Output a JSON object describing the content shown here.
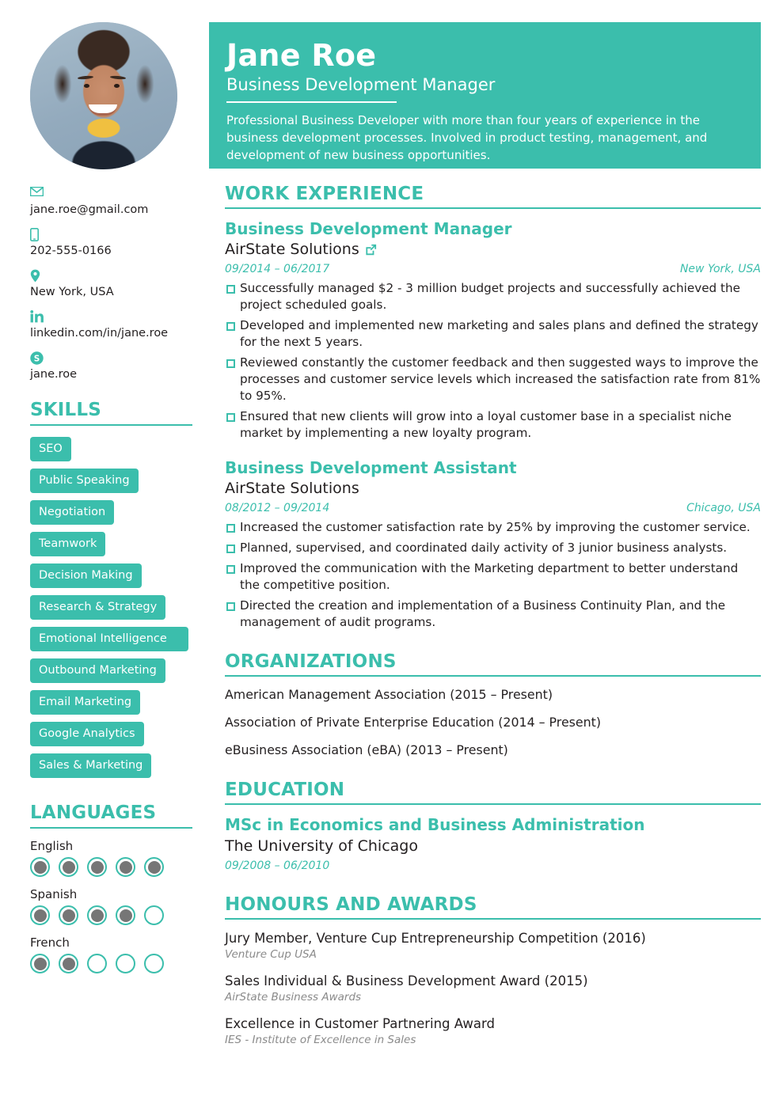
{
  "header": {
    "name": "Jane Roe",
    "role": "Business Development Manager",
    "summary": "Professional Business Developer with more than four years of experience in the business development processes. Involved in product testing, management, and development of new business opportunities.",
    "accent_color": "#3bbeac"
  },
  "contact": [
    {
      "icon": "envelope-icon",
      "text": "jane.roe@gmail.com"
    },
    {
      "icon": "phone-icon",
      "text": "202-555-0166"
    },
    {
      "icon": "location-pin-icon",
      "text": "New York, USA"
    },
    {
      "icon": "linkedin-icon",
      "text": "linkedin.com/in/jane.roe"
    },
    {
      "icon": "skype-icon",
      "text": "jane.roe"
    }
  ],
  "skills": {
    "heading": "SKILLS",
    "items": [
      "SEO",
      "Public Speaking",
      "Negotiation",
      "Teamwork",
      "Decision Making",
      "Research & Strategy",
      "Emotional Intelligence",
      "Outbound Marketing",
      "Email Marketing",
      "Google Analytics",
      "Sales & Marketing"
    ]
  },
  "languages": {
    "heading": "LANGUAGES",
    "items": [
      {
        "name": "English",
        "level": 5,
        "max": 5
      },
      {
        "name": "Spanish",
        "level": 4,
        "max": 5
      },
      {
        "name": "French",
        "level": 2,
        "max": 5
      }
    ]
  },
  "work_experience": {
    "heading": "WORK EXPERIENCE",
    "jobs": [
      {
        "title": "Business Development Manager",
        "company": "AirState Solutions",
        "has_link": true,
        "dates": "09/2014 – 06/2017",
        "location": "New York, USA",
        "bullets": [
          "Successfully managed $2 - 3 million budget projects and successfully achieved the project scheduled goals.",
          "Developed and implemented new marketing and sales plans and defined the strategy for the next 5 years.",
          "Reviewed constantly the customer feedback and then suggested ways to improve the processes and customer service levels which increased the satisfaction rate from 81% to 95%.",
          "Ensured that new clients will grow into a loyal customer base in a specialist niche market by implementing a new loyalty program."
        ]
      },
      {
        "title": "Business Development Assistant",
        "company": "AirState Solutions",
        "has_link": false,
        "dates": "08/2012 – 09/2014",
        "location": "Chicago, USA",
        "bullets": [
          "Increased the customer satisfaction rate by 25% by improving the customer service.",
          "Planned, supervised, and coordinated daily activity of 3 junior business analysts.",
          "Improved the communication with the Marketing department to better understand the competitive position.",
          "Directed the creation and implementation of a Business Continuity Plan, and the management of audit programs."
        ]
      }
    ]
  },
  "organizations": {
    "heading": "ORGANIZATIONS",
    "items": [
      "American Management Association (2015 – Present)",
      "Association of Private Enterprise Education (2014 – Present)",
      "eBusiness Association (eBA) (2013 – Present)"
    ]
  },
  "education": {
    "heading": "EDUCATION",
    "entries": [
      {
        "degree": "MSc in Economics and Business Administration",
        "school": "The University of Chicago",
        "dates": "09/2008 – 06/2010"
      }
    ]
  },
  "honours": {
    "heading": "HONOURS AND AWARDS",
    "items": [
      {
        "title": "Jury Member, Venture Cup Entrepreneurship Competition (2016)",
        "subtitle": "Venture Cup USA"
      },
      {
        "title": "Sales Individual & Business Development Award (2015)",
        "subtitle": "AirState Business Awards"
      },
      {
        "title": "Excellence in Customer Partnering Award",
        "subtitle": "IES - Institute of Excellence in Sales"
      }
    ]
  }
}
